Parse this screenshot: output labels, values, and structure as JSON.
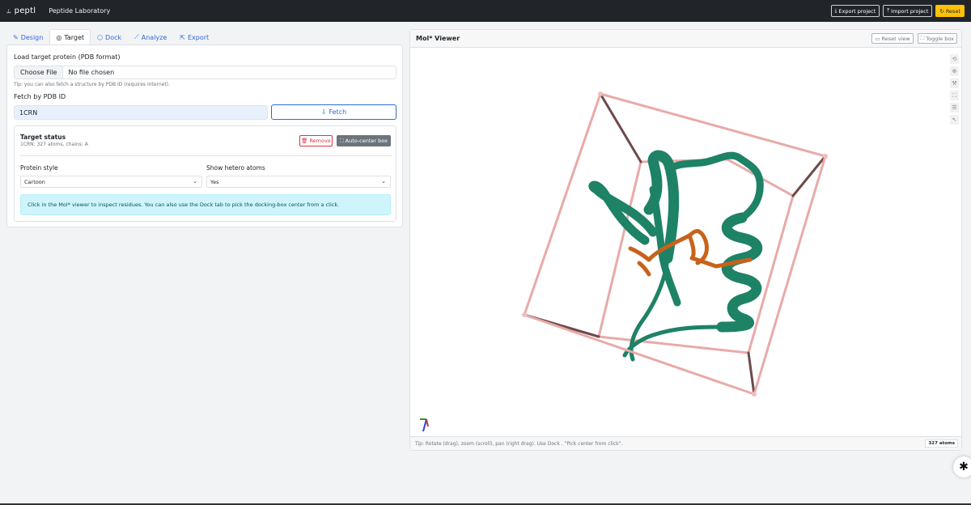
{
  "topbar": {
    "brand_icon": "⥿",
    "brand": "peptl",
    "title": "Peptide Laboratory",
    "export_project": "Export project",
    "import_project": "Import project",
    "reset": "Reset"
  },
  "tabs": [
    {
      "label": "Design",
      "icon": "✎"
    },
    {
      "label": "Target",
      "icon": "◎"
    },
    {
      "label": "Dock",
      "icon": "⬡"
    },
    {
      "label": "Analyze",
      "icon": "⟋"
    },
    {
      "label": "Export",
      "icon": "⇱"
    }
  ],
  "target": {
    "load_label": "Load target protein (PDB format)",
    "choose_file": "Choose File",
    "no_file": "No file chosen",
    "tip": "Tip: you can also fetch a structure by PDB ID (requires internet).",
    "fetch_label": "Fetch by PDB ID",
    "pdb_value": "1CRN",
    "fetch_button": "Fetch",
    "status_title": "Target status",
    "status_sub": "1CRN: 327 atoms, chains: A",
    "remove_button": "Remove",
    "autocenter_button": "Auto-center box",
    "protein_style_label": "Protein style",
    "protein_style_value": "Cartoon",
    "hetero_label": "Show hetero atoms",
    "hetero_value": "Yes",
    "info": "Click in the Mol* viewer to inspect residues. You can also use the Dock tab to pick the docking-box center from a click."
  },
  "viewer": {
    "title": "Mol* Viewer",
    "reset_view": "Reset view",
    "toggle_box": "Toggle box",
    "footer_tip": "Tip: Rotate (drag), zoom (scroll), pan (right drag). Use Dock   . \"Pick center from click\".",
    "atoms_badge": "327 atoms",
    "colors": {
      "protein": "#1e8266",
      "ligand": "#c8621b",
      "box": "#e8aaa8"
    }
  }
}
